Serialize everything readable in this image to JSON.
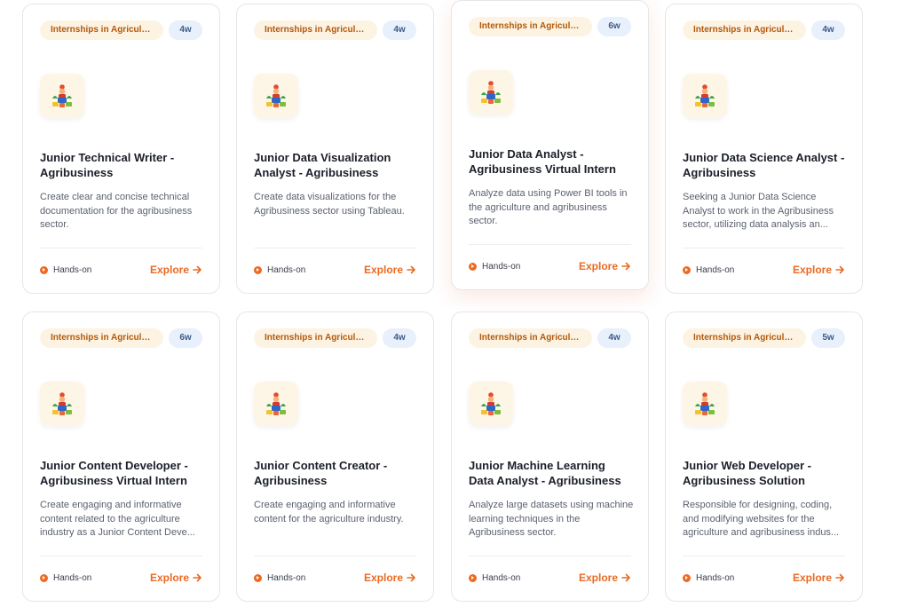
{
  "theme": {
    "accent": "#ea6a22",
    "tag_bg": "#fdf3e3",
    "badge_bg": "#e8f0fc"
  },
  "cards": [
    {
      "category": "Internships in Agricultur...",
      "duration": "4w",
      "logo_icon": "farmer-logo-icon",
      "title": "Junior Technical Writer - Agribusiness",
      "description": "Create clear and concise technical documentation for the agribusiness sector.",
      "mode": "Hands-on",
      "cta": "Explore"
    },
    {
      "category": "Internships in Agricultur...",
      "duration": "4w",
      "logo_icon": "farmer-logo-icon",
      "title": "Junior Data Visualization Analyst - Agribusiness",
      "description": "Create data visualizations for the Agribusiness sector using Tableau.",
      "mode": "Hands-on",
      "cta": "Explore"
    },
    {
      "category": "Internships in Agricultur...",
      "duration": "6w",
      "logo_icon": "farmer-logo-icon",
      "title": "Junior Data Analyst - Agribusiness Virtual Intern",
      "description": "Analyze data using Power BI tools in the agriculture and agribusiness sector.",
      "mode": "Hands-on",
      "cta": "Explore"
    },
    {
      "category": "Internships in Agricultur...",
      "duration": "4w",
      "logo_icon": "farmer-logo-icon",
      "title": "Junior Data Science Analyst - Agribusiness",
      "description": "Seeking a Junior Data Science Analyst to work in the Agribusiness sector, utilizing data analysis an...",
      "mode": "Hands-on",
      "cta": "Explore"
    },
    {
      "category": "Internships in Agricultur...",
      "duration": "6w",
      "logo_icon": "farmer-logo-icon",
      "title": "Junior Content Developer - Agribusiness Virtual Intern",
      "description": "Create engaging and informative content related to the agriculture industry as a Junior Content Deve...",
      "mode": "Hands-on",
      "cta": "Explore"
    },
    {
      "category": "Internships in Agricultur...",
      "duration": "4w",
      "logo_icon": "farmer-logo-icon",
      "title": "Junior Content Creator - Agribusiness",
      "description": "Create engaging and informative content for the agriculture industry.",
      "mode": "Hands-on",
      "cta": "Explore"
    },
    {
      "category": "Internships in Agricultur...",
      "duration": "4w",
      "logo_icon": "farmer-logo-icon",
      "title": "Junior Machine Learning Data Analyst - Agribusiness",
      "description": "Analyze large datasets using machine learning techniques in the Agribusiness sector.",
      "mode": "Hands-on",
      "cta": "Explore"
    },
    {
      "category": "Internships in Agricultur...",
      "duration": "5w",
      "logo_icon": "farmer-logo-icon",
      "title": "Junior Web Developer - Agribusiness Solution",
      "description": "Responsible for designing, coding, and modifying websites for the agriculture and agribusiness indus...",
      "mode": "Hands-on",
      "cta": "Explore"
    }
  ]
}
